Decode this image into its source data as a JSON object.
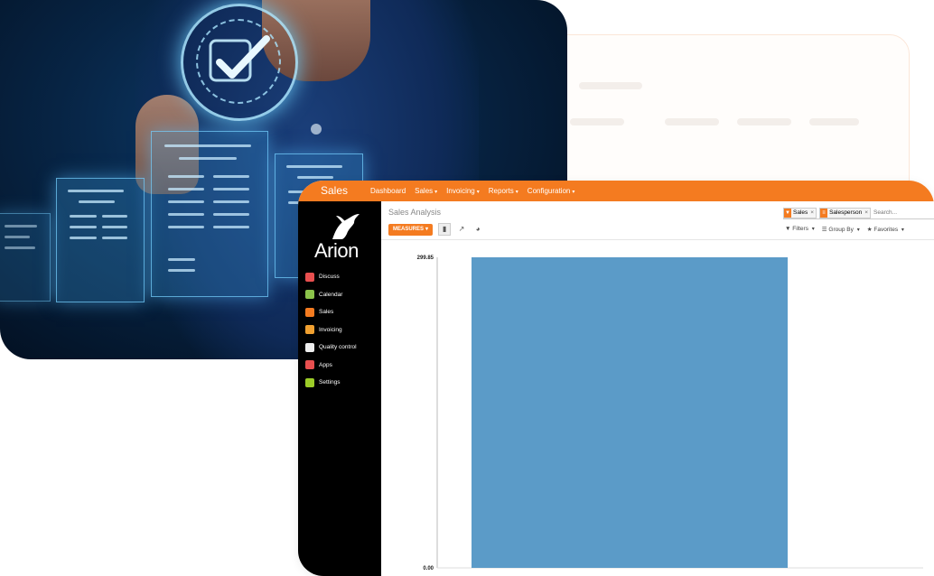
{
  "app": {
    "brand": "Sales",
    "menu": [
      {
        "label": "Dashboard",
        "caret": ""
      },
      {
        "label": "Sales",
        "caret": "▾"
      },
      {
        "label": "Invoicing",
        "caret": "▾"
      },
      {
        "label": "Reports",
        "caret": "▾"
      },
      {
        "label": "Configuration",
        "caret": "▾"
      }
    ],
    "logo_text": "Arion",
    "sidebar": [
      {
        "label": "Discuss",
        "icon": "chat-icon",
        "color": "#e84f4f"
      },
      {
        "label": "Calendar",
        "icon": "calendar-icon",
        "color": "#8bc34a"
      },
      {
        "label": "Sales",
        "icon": "chart-line-icon",
        "color": "#f47b20"
      },
      {
        "label": "Invoicing",
        "icon": "invoice-icon",
        "color": "#f0a030"
      },
      {
        "label": "Quality control",
        "icon": "quality-icon",
        "color": "#eeeeee"
      },
      {
        "label": "Apps",
        "icon": "apps-icon",
        "color": "#e84f4f"
      },
      {
        "label": "Settings",
        "icon": "gear-icon",
        "color": "#9ccc28"
      }
    ],
    "view_title": "Sales Analysis",
    "facets": [
      {
        "label": "Sales",
        "icon": "filter-icon"
      },
      {
        "label": "Salesperson",
        "icon": "group-icon"
      }
    ],
    "search_placeholder": "Search...",
    "measures_label": "MEASURES",
    "filters_label": "Filters",
    "group_by_label": "Group By",
    "favorites_label": "Favorites"
  },
  "colors": {
    "accent": "#f47b20",
    "bar": "#5b9bc8"
  },
  "chart_data": {
    "type": "bar",
    "categories": [
      ""
    ],
    "values": [
      299.85
    ],
    "ylim": [
      0,
      299.85
    ],
    "yticks": [
      "299.85",
      "0.00"
    ],
    "grid": false
  }
}
